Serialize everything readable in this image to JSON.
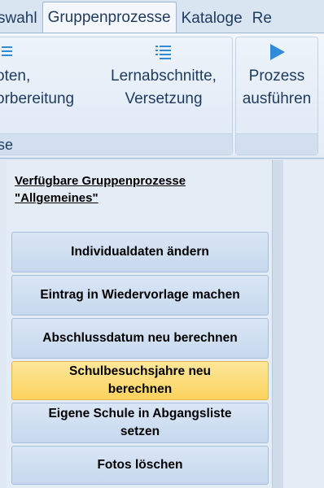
{
  "tabs": [
    {
      "label": "swahl"
    },
    {
      "label": "Gruppenprozesse"
    },
    {
      "label": "Kataloge"
    },
    {
      "label": "Re"
    }
  ],
  "ribbon": {
    "btn1": {
      "line1": "oten,",
      "line2": "orbereitung"
    },
    "btn2": {
      "line1": "Lernabschnitte,",
      "line2": "Versetzung",
      "icon": "list-icon"
    },
    "btn3": {
      "line1": "Prozess",
      "line2": "ausführen",
      "icon": "play-icon"
    },
    "group_label": "se"
  },
  "panel": {
    "heading_line1": "Verfügbare Gruppenprozesse",
    "heading_line2": "\"Allgemeines\"",
    "buttons": [
      {
        "line1": "Individualdaten ändern",
        "line2": ""
      },
      {
        "line1": "Eintrag in Wiedervorlage machen",
        "line2": ""
      },
      {
        "line1": "Abschlussdatum neu berechnen",
        "line2": ""
      },
      {
        "line1": "Schulbesuchsjahre neu",
        "line2": "berechnen"
      },
      {
        "line1": "Eigene Schule in Abgangsliste",
        "line2": "setzen"
      },
      {
        "line1": "Fotos löschen",
        "line2": ""
      }
    ]
  },
  "colors": {
    "accent": "#2f8ad8",
    "highlight": "#fbd25d"
  }
}
